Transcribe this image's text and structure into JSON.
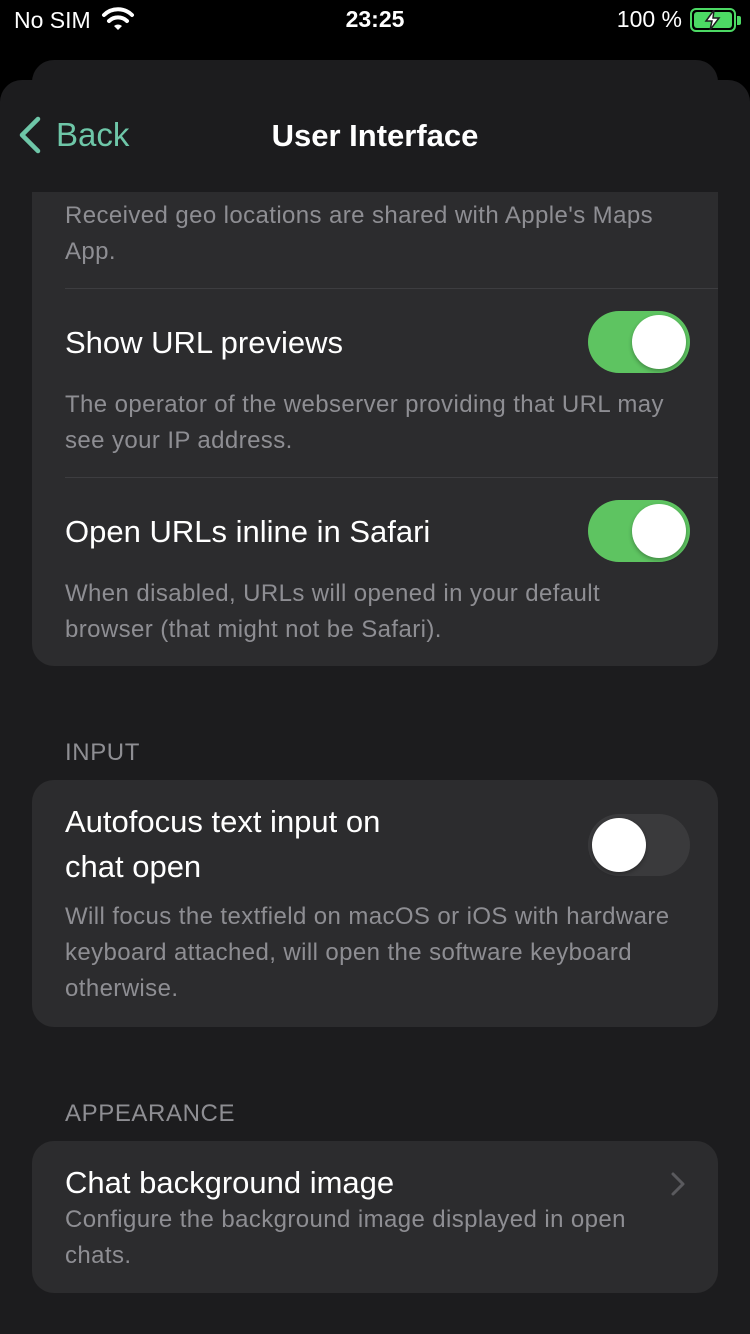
{
  "status_bar": {
    "carrier": "No SIM",
    "time": "23:25",
    "battery": "100 %"
  },
  "nav": {
    "back_label": "Back",
    "title": "User Interface"
  },
  "sections": {
    "top": {
      "geo_desc": "Received geo locations are shared with Apple's Maps App.",
      "url_previews": {
        "title": "Show URL previews",
        "enabled": true,
        "desc": "The operator of the webserver providing that URL may see your IP address."
      },
      "open_inline": {
        "title": "Open URLs inline in Safari",
        "enabled": true,
        "desc": "When disabled, URLs will opened in your default browser (that might not be Safari)."
      }
    },
    "input": {
      "header": "INPUT",
      "autofocus": {
        "title_line1": "Autofocus text input on",
        "title_line2": "chat open",
        "enabled": false,
        "desc": "Will focus the textfield on macOS or iOS with hardware keyboard attached, will open the software keyboard otherwise."
      }
    },
    "appearance": {
      "header": "APPEARANCE",
      "background": {
        "title": "Chat background image",
        "desc": "Configure the background image displayed in open chats."
      }
    }
  },
  "colors": {
    "accent": "#6ec6a8",
    "toggle_on": "#5ec461",
    "background": "#1c1c1e",
    "card": "#2c2c2e"
  }
}
